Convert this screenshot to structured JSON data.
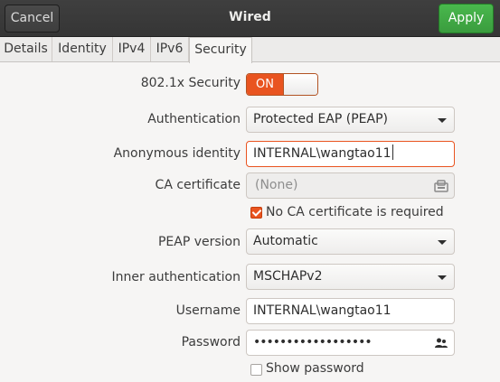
{
  "header": {
    "title": "Wired",
    "cancel_label": "Cancel",
    "apply_label": "Apply"
  },
  "tabs": [
    {
      "label": "Details",
      "active": false
    },
    {
      "label": "Identity",
      "active": false
    },
    {
      "label": "IPv4",
      "active": false
    },
    {
      "label": "IPv6",
      "active": false
    },
    {
      "label": "Security",
      "active": true
    }
  ],
  "form": {
    "security_8021x": {
      "label": "802.1x Security",
      "state": "ON"
    },
    "authentication": {
      "label": "Authentication",
      "value": "Protected EAP (PEAP)"
    },
    "anonymous_identity": {
      "label": "Anonymous identity",
      "value": "INTERNAL\\wangtao11"
    },
    "ca_certificate": {
      "label": "CA certificate",
      "value": "(None)",
      "icon": "certificate-icon"
    },
    "no_ca_required": {
      "label": "No CA certificate is required",
      "checked": true
    },
    "peap_version": {
      "label": "PEAP version",
      "value": "Automatic"
    },
    "inner_auth": {
      "label": "Inner authentication",
      "value": "MSCHAPv2"
    },
    "username": {
      "label": "Username",
      "value": "INTERNAL\\wangtao11"
    },
    "password": {
      "label": "Password",
      "value": "••••••••••••••••••",
      "icon": "users-icon"
    },
    "show_password": {
      "label": "Show password",
      "checked": false
    }
  },
  "colors": {
    "accent": "#e95420",
    "apply_green": "#3a9c3e",
    "headerbar": "#393939"
  }
}
